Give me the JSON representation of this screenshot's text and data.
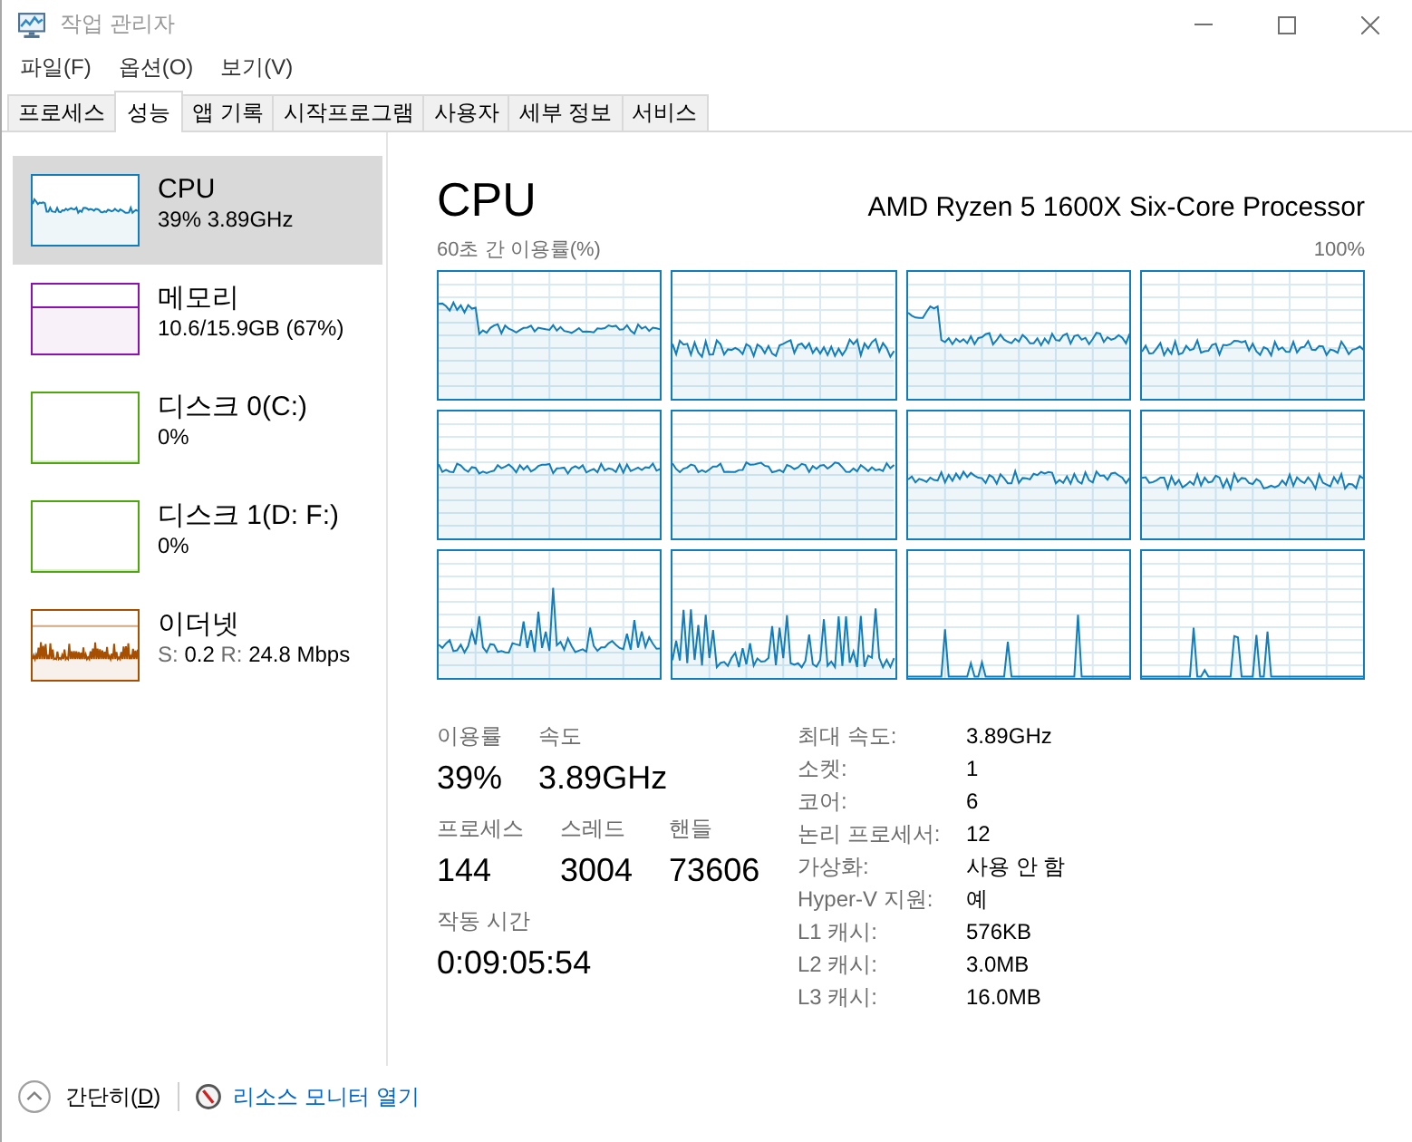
{
  "window": {
    "title": "작업 관리자"
  },
  "menu": [
    "파일(F)",
    "옵션(O)",
    "보기(V)"
  ],
  "tabs": [
    {
      "label": "프로세스",
      "selected": false
    },
    {
      "label": "성능",
      "selected": true
    },
    {
      "label": "앱 기록",
      "selected": false
    },
    {
      "label": "시작프로그램",
      "selected": false
    },
    {
      "label": "사용자",
      "selected": false
    },
    {
      "label": "세부 정보",
      "selected": false
    },
    {
      "label": "서비스",
      "selected": false
    }
  ],
  "sidebar": {
    "items": [
      {
        "kind": "cpu",
        "color": "#117dbb",
        "title": "CPU",
        "detail": [
          {
            "text": "39% 3.89GHz",
            "muted": false
          }
        ],
        "selected": true
      },
      {
        "kind": "memory",
        "color": "#8b12ae",
        "title": "메모리",
        "detail": [
          {
            "text": "10.6/15.9GB (67%)",
            "muted": false
          }
        ],
        "selected": false
      },
      {
        "kind": "disk",
        "color": "#4da60c",
        "title": "디스크 0(C:)",
        "detail": [
          {
            "text": "0%",
            "muted": false
          }
        ],
        "selected": false
      },
      {
        "kind": "disk",
        "color": "#4da60c",
        "title": "디스크 1(D: F:)",
        "detail": [
          {
            "text": "0%",
            "muted": false
          }
        ],
        "selected": false
      },
      {
        "kind": "network",
        "color": "#a74f01",
        "title": "이더넷",
        "detail": [
          {
            "text": "S:",
            "muted": true
          },
          {
            "text": "0.2",
            "muted": false
          },
          {
            "text": "R:",
            "muted": true
          },
          {
            "text": "24.8 Mbps",
            "muted": false
          }
        ],
        "selected": false
      }
    ]
  },
  "detail": {
    "title": "CPU",
    "model": "AMD Ryzen 5 1600X Six-Core Processor",
    "graph_caption": "60초 간 이용률(%)",
    "graph_max": "100%",
    "stat_rows": [
      [
        {
          "label": "이용률",
          "value": "39%"
        },
        {
          "label": "속도",
          "value": "3.89GHz"
        }
      ],
      [
        {
          "label": "프로세스",
          "value": "144"
        },
        {
          "label": "스레드",
          "value": "3004"
        },
        {
          "label": "핸들",
          "value": "73606"
        }
      ],
      [
        {
          "label": "작동 시간",
          "value": "0:09:05:54"
        }
      ]
    ],
    "specs": [
      {
        "label": "최대 속도:",
        "value": "3.89GHz"
      },
      {
        "label": "소켓:",
        "value": "1"
      },
      {
        "label": "코어:",
        "value": "6"
      },
      {
        "label": "논리 프로세서:",
        "value": "12"
      },
      {
        "label": "가상화:",
        "value": "사용 안 함"
      },
      {
        "label": "Hyper-V 지원:",
        "value": "예"
      },
      {
        "label": "L1 캐시:",
        "value": "576KB"
      },
      {
        "label": "L2 캐시:",
        "value": "3.0MB"
      },
      {
        "label": "L3 캐시:",
        "value": "16.0MB"
      }
    ]
  },
  "footer": {
    "collapse": {
      "before": "간단히(",
      "key": "D",
      "after": ")"
    },
    "link": "리소스 모니터 열기"
  }
}
